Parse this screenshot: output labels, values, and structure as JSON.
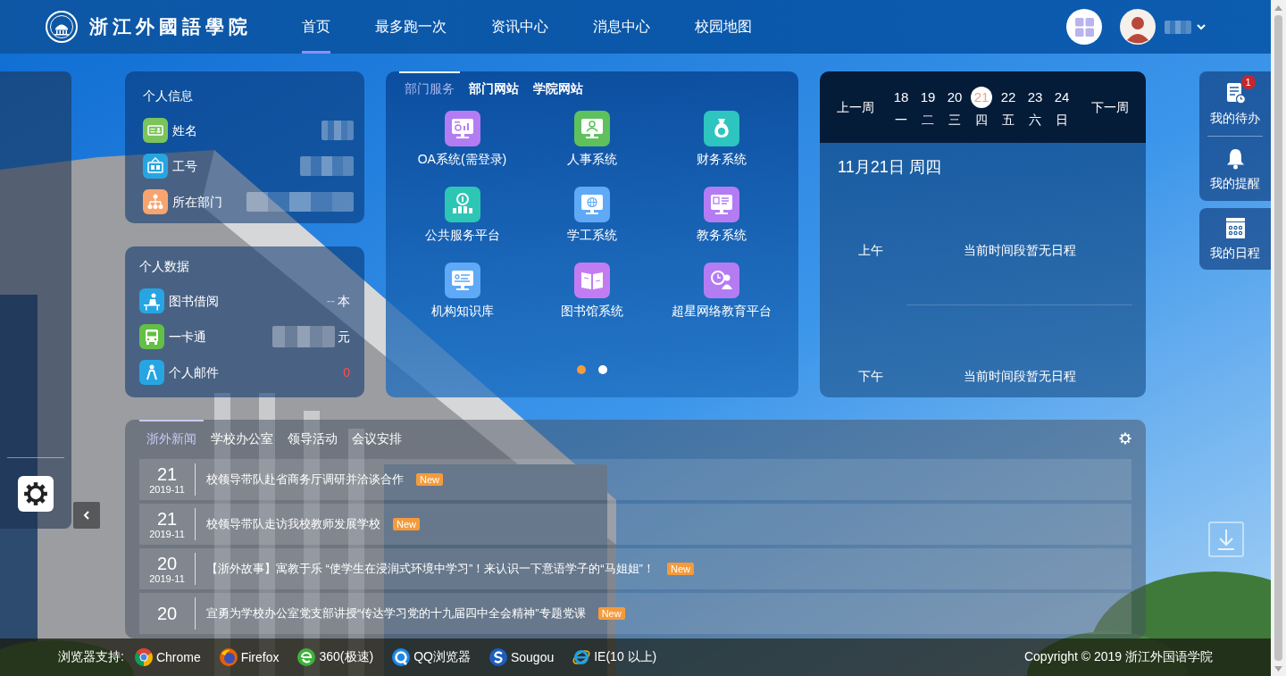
{
  "header": {
    "logo_text": "浙江外國語學院",
    "nav": [
      {
        "label": "首页",
        "selected": true
      },
      {
        "label": "最多跑一次",
        "selected": false
      },
      {
        "label": "资讯中心",
        "selected": false
      },
      {
        "label": "消息中心",
        "selected": false
      },
      {
        "label": "校园地图",
        "selected": false
      }
    ],
    "user": {
      "name_redacted": true
    }
  },
  "personal_info": {
    "title": "个人信息",
    "items": [
      {
        "label": "姓名",
        "color": "#7bc35c",
        "redacted": true
      },
      {
        "label": "工号",
        "color": "#27a5e2",
        "redacted": true
      },
      {
        "label": "所在部门",
        "color": "#f7a46e",
        "redacted": true
      }
    ]
  },
  "personal_data": {
    "title": "个人数据",
    "items": [
      {
        "label": "图书借阅",
        "color": "#27a5e2",
        "redacted": false,
        "value": {
          "text": "--",
          "color": "#9ad6cf"
        },
        "unit": "本"
      },
      {
        "label": "一卡通",
        "color": "#63bf46",
        "redacted": true,
        "unit": "元"
      },
      {
        "label": "个人邮件",
        "color": "#27a5e2",
        "redacted": false,
        "value": {
          "text": "0",
          "color": "#ff4d4f"
        }
      }
    ]
  },
  "services": {
    "tabs": [
      {
        "label": "部门服务",
        "selected": true
      },
      {
        "label": "部门网站",
        "selected": false
      },
      {
        "label": "学院网站",
        "selected": false
      }
    ],
    "items": [
      {
        "label": "OA系统(需登录)",
        "color": "#b47cf3"
      },
      {
        "label": "人事系统",
        "color": "#5ec15c"
      },
      {
        "label": "财务系统",
        "color": "#2ec4bf"
      },
      {
        "label": "公共服务平台",
        "color": "#2dc6b5"
      },
      {
        "label": "学工系统",
        "color": "#5fa9f7"
      },
      {
        "label": "教务系统",
        "color": "#b47cf3"
      },
      {
        "label": "机构知识库",
        "color": "#5fa9f7"
      },
      {
        "label": "图书馆系统",
        "color": "#c27cf2"
      },
      {
        "label": "超星网络教育平台",
        "color": "#b47cf3"
      }
    ],
    "pages": [
      {
        "selected": true
      },
      {
        "selected": false
      }
    ]
  },
  "calendar": {
    "prev": "上一周",
    "next": "下一周",
    "days": [
      {
        "date": "18",
        "weekday": "一",
        "selected": false
      },
      {
        "date": "19",
        "weekday": "二",
        "selected": false
      },
      {
        "date": "20",
        "weekday": "三",
        "selected": false
      },
      {
        "date": "21",
        "weekday": "四",
        "selected": true
      },
      {
        "date": "22",
        "weekday": "五",
        "selected": false
      },
      {
        "date": "23",
        "weekday": "六",
        "selected": false
      },
      {
        "date": "24",
        "weekday": "日",
        "selected": false
      }
    ],
    "heading": "11月21日 周四",
    "periods": [
      {
        "label": "上午",
        "text": "当前时间段暂无日程"
      },
      {
        "label": "下午",
        "text": "当前时间段暂无日程"
      }
    ]
  },
  "dock": {
    "panels": [
      {
        "items": [
          {
            "kind": "tasks",
            "label": "我的待办",
            "badge": "1"
          },
          {
            "kind": "reminders",
            "label": "我的提醒"
          }
        ]
      },
      {
        "items": [
          {
            "kind": "schedule",
            "label": "我的日程"
          }
        ]
      }
    ]
  },
  "news": {
    "tabs": [
      {
        "label": "浙外新闻",
        "selected": true
      },
      {
        "label": "学校办公室",
        "selected": false
      },
      {
        "label": "领导活动",
        "selected": false
      },
      {
        "label": "会议安排",
        "selected": false
      }
    ],
    "items": [
      {
        "day": "21",
        "month": "2019-11",
        "title": "校领导带队赴省商务厅调研并洽谈合作",
        "badge": "New"
      },
      {
        "day": "21",
        "month": "2019-11",
        "title": "校领导带队走访我校教师发展学校",
        "badge": "New"
      },
      {
        "day": "20",
        "month": "2019-11",
        "title": "【浙外故事】寓教于乐 “使学生在浸润式环境中学习”！来认识一下意语学子的“马姐姐”！",
        "badge": "New"
      },
      {
        "day": "20",
        "title": "宣勇为学校办公室党支部讲授“传达学习党的十九届四中全会精神”专题党课",
        "badge": "New"
      }
    ]
  },
  "footer": {
    "label": "浏览器支持:",
    "browsers": [
      "Chrome",
      "Firefox",
      "360(极速)",
      "QQ浏览器",
      "Sougou",
      "IE(10 以上)"
    ],
    "copyright": "Copyright © 2019 浙江外国语学院"
  }
}
